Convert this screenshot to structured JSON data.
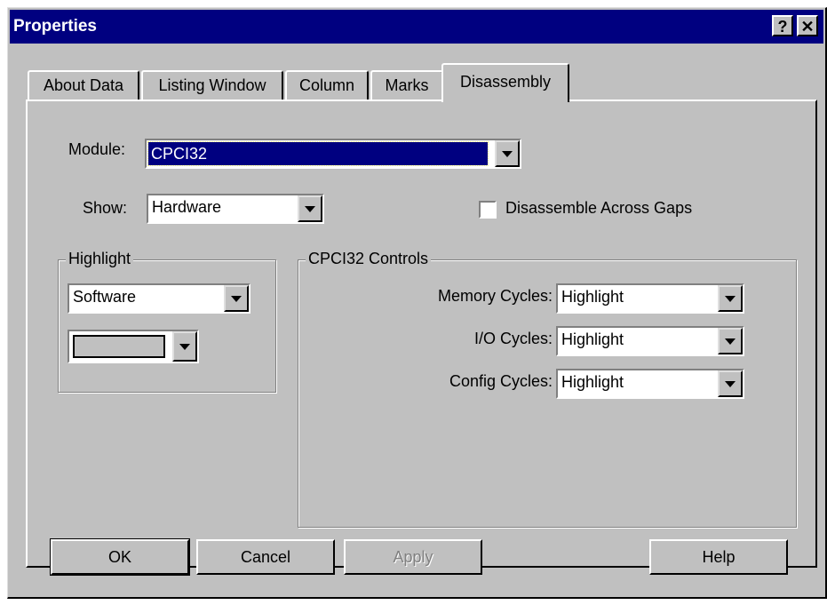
{
  "window": {
    "title": "Properties",
    "help_glyph": "?",
    "close_glyph": "✕"
  },
  "tabs": [
    {
      "label": "About Data"
    },
    {
      "label": "Listing Window"
    },
    {
      "label": "Column"
    },
    {
      "label": "Marks"
    },
    {
      "label": "Disassembly",
      "active": true
    }
  ],
  "module": {
    "label": "Module:",
    "value": "CPCI32"
  },
  "show": {
    "label": "Show:",
    "value": "Hardware"
  },
  "disassemble_gaps": {
    "label": "Disassemble Across Gaps",
    "checked": false
  },
  "highlight": {
    "title": "Highlight",
    "value": "Software",
    "color_value": ""
  },
  "controls": {
    "title": "CPCI32 Controls",
    "rows": [
      {
        "label": "Memory Cycles:",
        "value": "Highlight"
      },
      {
        "label": "I/O Cycles:",
        "value": "Highlight"
      },
      {
        "label": "Config Cycles:",
        "value": "Highlight"
      }
    ]
  },
  "buttons": {
    "ok": "OK",
    "cancel": "Cancel",
    "apply": "Apply",
    "help": "Help"
  },
  "colors": {
    "titlebar": "#000080",
    "face": "#c0c0c0",
    "selection": "#000080"
  }
}
